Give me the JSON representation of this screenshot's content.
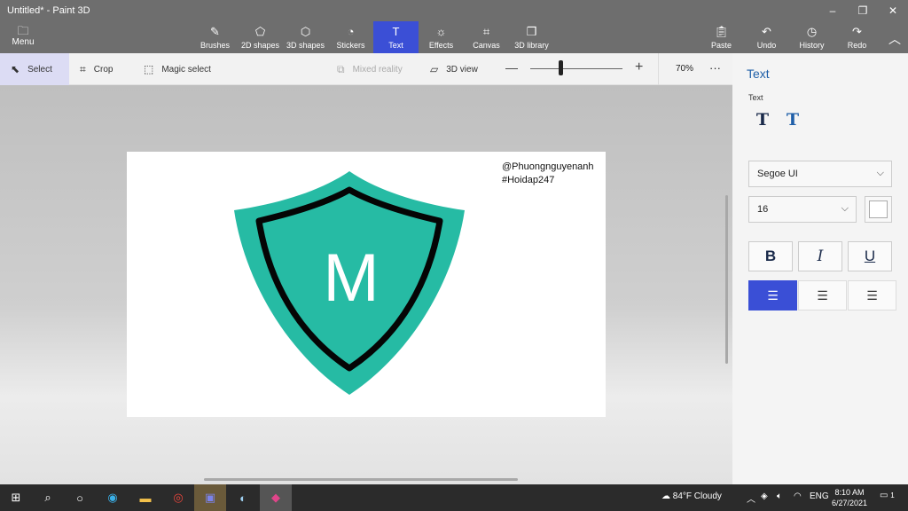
{
  "window": {
    "title": "Untitled* - Paint 3D"
  },
  "window_controls": {
    "minimize": "–",
    "restore": "❐",
    "close": "✕"
  },
  "ribbon": {
    "menu": {
      "label": "Menu",
      "icon": "folder-icon"
    },
    "tabs": [
      {
        "label": "Brushes",
        "icon": "brush-icon"
      },
      {
        "label": "2D shapes",
        "icon": "2d-shapes-icon"
      },
      {
        "label": "3D shapes",
        "icon": "3d-shapes-icon"
      },
      {
        "label": "Stickers",
        "icon": "stickers-icon"
      },
      {
        "label": "Text",
        "icon": "text-icon",
        "active": true
      },
      {
        "label": "Effects",
        "icon": "effects-icon"
      },
      {
        "label": "Canvas",
        "icon": "canvas-icon"
      },
      {
        "label": "3D library",
        "icon": "3d-library-icon"
      }
    ],
    "right_tools": [
      {
        "label": "Paste",
        "icon": "paste-icon"
      },
      {
        "label": "Undo",
        "icon": "undo-icon"
      },
      {
        "label": "History",
        "icon": "history-icon"
      },
      {
        "label": "Redo",
        "icon": "redo-icon"
      }
    ]
  },
  "toolbar": {
    "select": "Select",
    "crop": "Crop",
    "magic_select": "Magic select",
    "mixed_reality": "Mixed reality",
    "view_3d": "3D view",
    "zoom_minus": "—",
    "zoom_plus": "+",
    "zoom_value": "70%",
    "zoom_level_percent": 70,
    "more": "···"
  },
  "canvas": {
    "watermark_line1": "@Phuongnguyenanh",
    "watermark_line2": "#Hoidap247",
    "logo_letter": "M",
    "logo_color": "#26bba4"
  },
  "panel": {
    "title": "Text",
    "subtitle": "Text",
    "font": "Segoe UI",
    "size": "16",
    "bold": "B",
    "italic": "I",
    "underline": "U",
    "accent_color": "#3a4fd6"
  },
  "taskbar": {
    "weather": "84°F  Cloudy",
    "language": "ENG",
    "time": "8:10 AM",
    "date": "6/27/2021",
    "notification_count": "1"
  }
}
